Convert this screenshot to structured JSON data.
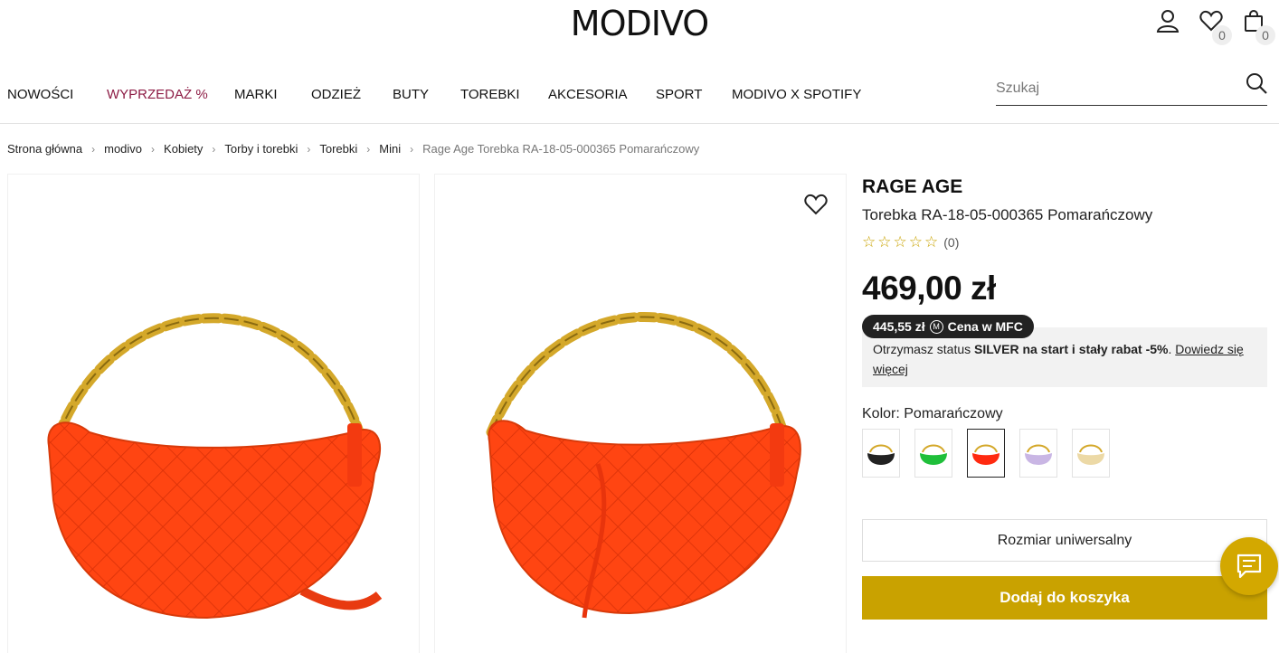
{
  "header": {
    "logo": "MODIVO",
    "wishlist_count": "0",
    "cart_count": "0"
  },
  "nav": {
    "items": [
      {
        "label": "NOWOŚCI"
      },
      {
        "label": "WYPRZEDAŻ %"
      },
      {
        "label": "MARKI"
      },
      {
        "label": "ODZIEŻ"
      },
      {
        "label": "BUTY"
      },
      {
        "label": "TOREBKI"
      },
      {
        "label": "AKCESORIA"
      },
      {
        "label": "SPORT"
      },
      {
        "label": "MODIVO X SPOTIFY"
      }
    ],
    "sale_color": "#8d1c45"
  },
  "search": {
    "placeholder": "Szukaj"
  },
  "breadcrumb": {
    "items": [
      "Strona główna",
      "modivo",
      "Kobiety",
      "Torby i torebki",
      "Torebki",
      "Mini"
    ],
    "current": "Rage Age Torebka RA-18-05-000365 Pomarańczowy"
  },
  "product": {
    "brand": "RAGE AGE",
    "name": "Torebka RA-18-05-000365 Pomarańczowy",
    "rating_count": "(0)",
    "rating_value": 0,
    "price": "469,00 zł",
    "mfc": {
      "price": "445,55 zł",
      "icon": "M",
      "label": "Cena w MFC",
      "text_prefix": "Otrzymasz status ",
      "text_bold": "SILVER na start i stały rabat -5%",
      "text_suffix": ". ",
      "link": "Dowiedz się więcej"
    },
    "color_label": "Kolor:",
    "color_value": "Pomarańczowy",
    "swatches": [
      {
        "color": "#222222",
        "selected": false
      },
      {
        "color": "#1fbf3a",
        "selected": false
      },
      {
        "color": "#ff2a10",
        "selected": true
      },
      {
        "color": "#c9b6e4",
        "selected": false
      },
      {
        "color": "#ecd9a6",
        "selected": false
      }
    ],
    "size": "Rozmiar uniwersalny",
    "add_to_cart": "Dodaj do koszyka"
  },
  "colors": {
    "accent": "#c9a200",
    "bag": "#ff4a12",
    "chain": "#d4a82a"
  }
}
